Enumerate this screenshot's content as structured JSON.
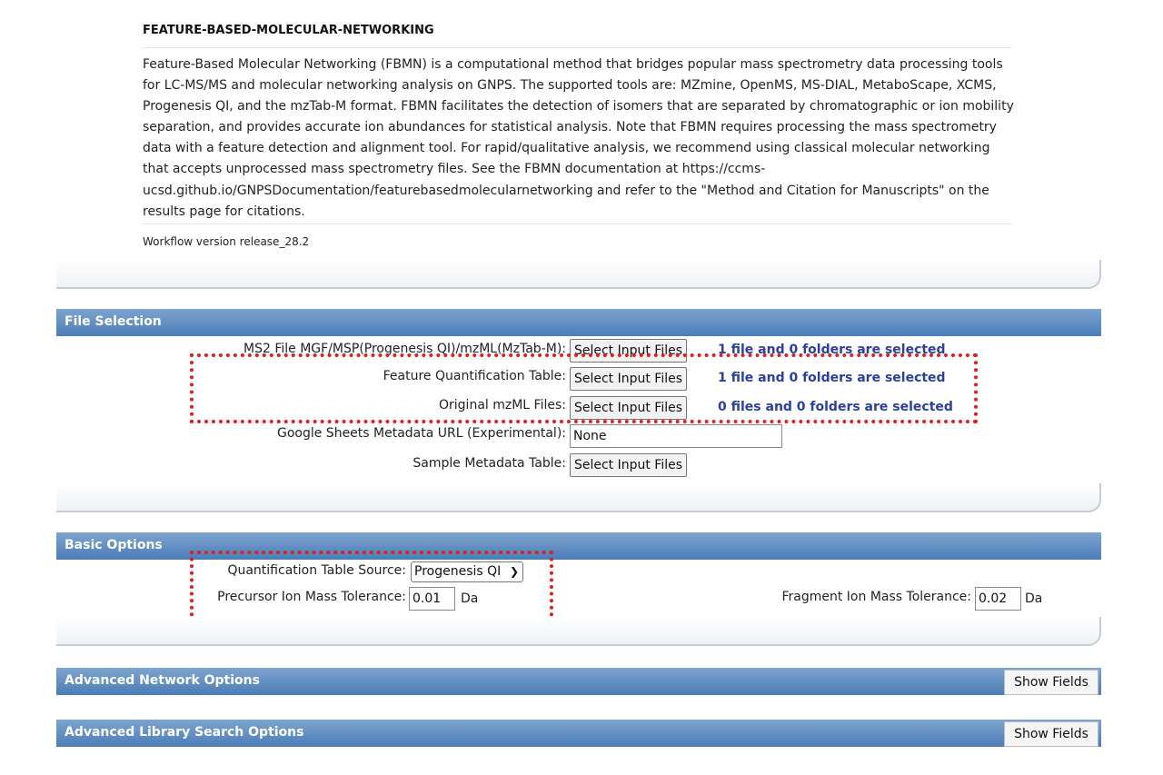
{
  "workflow": {
    "title": "FEATURE-BASED-MOLECULAR-NETWORKING",
    "description": "Feature-Based Molecular Networking (FBMN) is a computational method that bridges popular mass spectrometry data processing tools for LC-MS/MS and molecular networking analysis on GNPS. The supported tools are: MZmine, OpenMS, MS-DIAL, MetaboScape, XCMS, Progenesis QI, and the mzTab-M format. FBMN facilitates the detection of isomers that are separated by chromatographic or ion mobility separation, and provides accurate ion abundances for statistical analysis. Note that FBMN requires processing the mass spectrometry data with a feature detection and alignment tool. For rapid/qualitative analysis, we recommend using classical molecular networking that accepts unprocessed mass spectrometry files. See the FBMN documentation at https://ccms-ucsd.github.io/GNPSDocumentation/featurebasedmolecularnetworking and refer to the \"Method and Citation for Manuscripts\" on the results page for citations.",
    "version": "Workflow version release_28.2"
  },
  "file_selection": {
    "header": "File Selection",
    "button_label": "Select Input Files",
    "ms2_label": "MS2 File MGF/MSP(Progenesis QI)/mzML(MzTab-M):",
    "ms2_status": "1 file and 0 folders are selected",
    "quant_label": "Feature Quantification Table:",
    "quant_status": "1 file and 0 folders are selected",
    "mzml_label": "Original mzML Files:",
    "mzml_status": "0 files and 0 folders are selected",
    "sheets_label": "Google Sheets Metadata URL (Experimental):",
    "sheets_value": "None",
    "metadata_label": "Sample Metadata Table:"
  },
  "basic_options": {
    "header": "Basic Options",
    "quant_source_label": "Quantification Table Source:",
    "quant_source_value": "Progenesis QI",
    "precursor_label": "Precursor Ion Mass Tolerance:",
    "precursor_value": "0.01",
    "fragment_label": "Fragment Ion Mass Tolerance:",
    "fragment_value": "0.02",
    "unit": "Da"
  },
  "advanced_network": {
    "header": "Advanced Network Options",
    "button": "Show Fields"
  },
  "advanced_library": {
    "header": "Advanced Library Search Options",
    "button": "Show Fields"
  },
  "colors": {
    "section_header": "#5b8ac2",
    "status_text": "#2b3f9e",
    "highlight": "#e01e1e"
  }
}
